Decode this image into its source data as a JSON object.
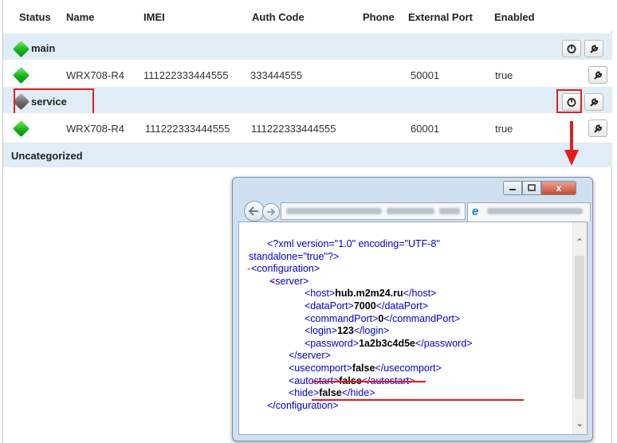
{
  "columns": [
    "Status",
    "Name",
    "IMEI",
    "Auth Code",
    "Phone",
    "External Port",
    "Enabled"
  ],
  "groups": [
    {
      "name": "main",
      "status_color": "green",
      "devices": [
        {
          "name": "WRX708-R4",
          "imei": "111222333444555",
          "auth_code": "333444555",
          "phone": "",
          "external_port": "50001",
          "enabled": "true"
        }
      ]
    },
    {
      "name": "service",
      "status_color": "gray",
      "devices": [
        {
          "name": "WRX708-R4",
          "imei": "111222333444555",
          "auth_code": "111222333444555",
          "phone": "",
          "external_port": "60001",
          "enabled": "true"
        }
      ]
    }
  ],
  "uncategorized_label": "Uncategorized",
  "icons": {
    "group_actions": [
      "power-icon",
      "wrench-icon"
    ],
    "device_actions": [
      "wrench-icon"
    ],
    "browser": [
      "back-arrow-icon",
      "forward-arrow-icon",
      "ie-icon"
    ]
  },
  "colors": {
    "group_row_bg": "#e0edf6",
    "highlight_red": "#e02020",
    "status_green": "#18b31e",
    "status_gray": "#6a6a6a",
    "xml_tag": "#990000",
    "xml_markup": "#0000cc"
  },
  "browser_window": {
    "close_label": "x",
    "xml_lines": [
      {
        "collapse": "",
        "open": "<?xml version=\"1.0\" encoding=\"UTF-8\"",
        "value": "",
        "close": ""
      },
      {
        "collapse": "",
        "open": "standalone=\"true\"?>",
        "value": "",
        "close": ""
      },
      {
        "collapse": "-",
        "open": "<configuration>",
        "value": "",
        "close": ""
      },
      {
        "collapse": "-",
        "open": "<server>",
        "value": "",
        "close": ""
      },
      {
        "collapse": "",
        "open": "<host>",
        "value": "hub.m2m24.ru",
        "close": "</host>"
      },
      {
        "collapse": "",
        "open": "<dataPort>",
        "value": "7000",
        "close": "</dataPort>"
      },
      {
        "collapse": "",
        "open": "<commandPort>",
        "value": "0",
        "close": "</commandPort>"
      },
      {
        "collapse": "",
        "open": "<login>",
        "value": "123",
        "close": "</login>"
      },
      {
        "collapse": "",
        "open": "<password>",
        "value": "1a2b3c4d5e",
        "close": "</password>"
      },
      {
        "collapse": "",
        "open": "</server>",
        "value": "",
        "close": ""
      },
      {
        "collapse": "",
        "open": "<usecomport>",
        "value": "false",
        "close": "</usecomport>"
      },
      {
        "collapse": "",
        "open": "<autostart>",
        "value": "false",
        "close": "</autostart>"
      },
      {
        "collapse": "",
        "open": "<hide>",
        "value": "false",
        "close": "</hide>"
      },
      {
        "collapse": "",
        "open": "</configuration>",
        "value": "",
        "close": ""
      }
    ]
  }
}
